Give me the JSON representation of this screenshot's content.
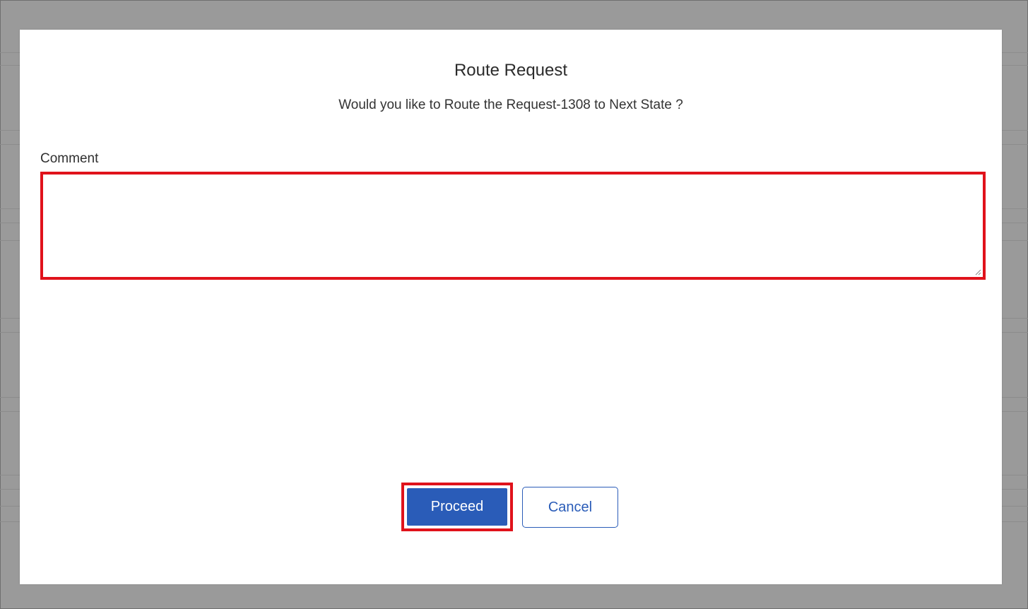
{
  "dialog": {
    "title": "Route Request",
    "question": "Would you like to Route the Request-1308 to Next State ?",
    "comment": {
      "label": "Comment",
      "value": "",
      "placeholder": ""
    },
    "proceed_label": "Proceed",
    "cancel_label": "Cancel"
  },
  "colors": {
    "overlay": "#9a9a9a",
    "primary": "#2a5cb8",
    "highlight": "#e0121b"
  },
  "icons": {
    "resize": "resize-handle-icon"
  }
}
